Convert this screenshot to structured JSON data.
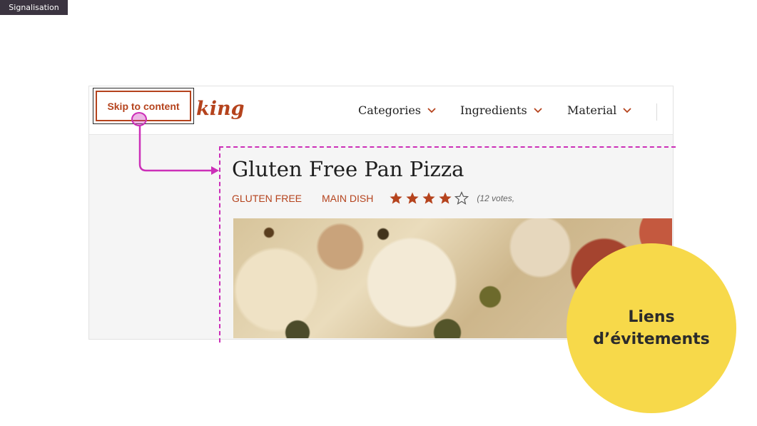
{
  "slide_tag": "Signalisation",
  "site": {
    "logo_text": "king",
    "nav": [
      {
        "label": "Categories"
      },
      {
        "label": "Ingredients"
      },
      {
        "label": "Material"
      }
    ],
    "skip_link_label": "Skip to content"
  },
  "recipe": {
    "title": "Gluten Free Pan Pizza",
    "tags": [
      "GLUTEN FREE",
      "MAIN DISH"
    ],
    "rating": {
      "value": 4,
      "max": 5
    },
    "votes_text": "(12 votes,"
  },
  "callout": {
    "line1": "Liens",
    "line2": "d’évitements"
  },
  "colors": {
    "brand": "#b5431d",
    "focus": "#cc2fb8",
    "callout_bg": "#f7d94a"
  },
  "icons": {
    "nav_chevron": "chevron-down-icon",
    "star_filled": "star-filled-icon",
    "star_empty": "star-empty-icon"
  }
}
